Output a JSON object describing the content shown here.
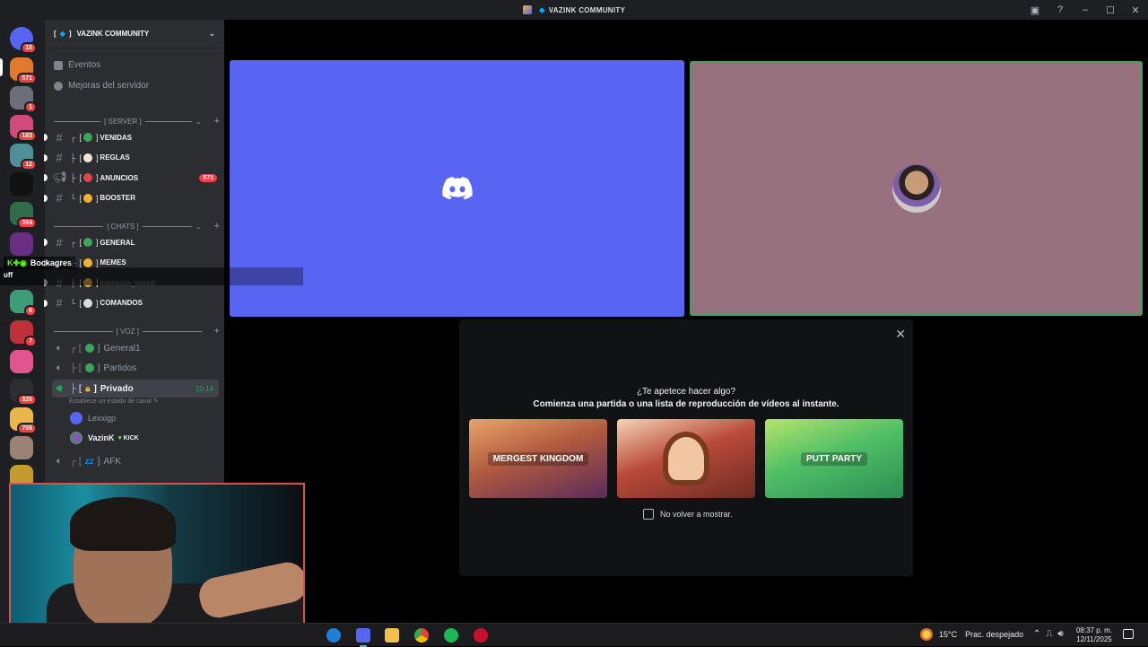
{
  "window": {
    "title": "VAZINK COMMUNITY",
    "title_prefix": "[",
    "title_suffix": "]"
  },
  "guild_bar": {
    "items": [
      {
        "name": "home-button",
        "badge": "15",
        "color": "#5865f2"
      },
      {
        "name": "guild-1",
        "badge": "571",
        "color": "#e07a2d"
      },
      {
        "name": "guild-squad",
        "badge": "1",
        "color": "#6d6f78"
      },
      {
        "name": "guild-3",
        "badge": "183",
        "color": "#d04a7a"
      },
      {
        "name": "guild-4",
        "badge": "12",
        "color": "#4e8f9a"
      },
      {
        "name": "guild-tiktok",
        "badge": "",
        "color": "#111111"
      },
      {
        "name": "guild-6",
        "badge": "364",
        "color": "#2f6d4a"
      },
      {
        "name": "guild-7",
        "badge": "",
        "color": "#6a2d84"
      },
      {
        "name": "guild-8",
        "badge": "6",
        "color": "#3c9d78"
      },
      {
        "name": "guild-9",
        "badge": "7",
        "color": "#c0303a"
      },
      {
        "name": "guild-10",
        "badge": "",
        "color": "#e1558f"
      },
      {
        "name": "guild-11",
        "badge": "320",
        "color": "#2b2d31"
      },
      {
        "name": "guild-12",
        "badge": "706",
        "color": "#e8b64a"
      },
      {
        "name": "guild-13",
        "badge": "",
        "color": "#9a8275"
      },
      {
        "name": "guild-14",
        "badge": "",
        "color": "#c49b2c"
      }
    ]
  },
  "sidebar": {
    "server_name": "VAZINK COMMUNITY",
    "top_items": [
      "Eventos",
      "Mejoras del servidor"
    ],
    "categories": {
      "server": "SERVER",
      "chats": "CHATS",
      "voz": "VOZ"
    },
    "server_channels": [
      {
        "name": "VENIDAS",
        "color": "#3ba55d"
      },
      {
        "name": "REGLAS",
        "color": "#f2e6d8"
      },
      {
        "name": "ANUNCIOS",
        "color": "#e0454b",
        "count": "571"
      },
      {
        "name": "BOOSTER",
        "color": "#f0b232"
      }
    ],
    "chat_channels": [
      {
        "name": "GENERAL",
        "color": "#3ba55d"
      },
      {
        "name": "MEMES",
        "color": "#f0b232"
      },
      {
        "name": "memazos_vazink",
        "color": "#f0b232"
      },
      {
        "name": "COMANDOS",
        "color": "#dbdee1"
      }
    ],
    "voice_channels": [
      {
        "name": "General1"
      },
      {
        "name": "Partidos"
      },
      {
        "name": "Privado",
        "time": "10:14",
        "status": "Establece un estado de canal"
      },
      {
        "name": "AFK"
      }
    ],
    "voice_users": [
      {
        "name": "Lexxigp"
      },
      {
        "name": "VazinK",
        "tag": "KICK"
      }
    ]
  },
  "overlay": {
    "follower": "Bockagres",
    "text": "uff"
  },
  "activity_panel": {
    "question": "¿Te apetece hacer algo?",
    "subtitle": "Comienza una partida o una lista de reproducción de vídeos al instante.",
    "cards": [
      "MERGEST KINGDOM",
      "",
      "PUTT PARTY"
    ],
    "checkbox_label": "No volver a mostrar."
  },
  "taskbar": {
    "temperature": "15°C",
    "condition": "Prac. despejado",
    "time": "08:37 p. m.",
    "date": "12/11/2025"
  }
}
